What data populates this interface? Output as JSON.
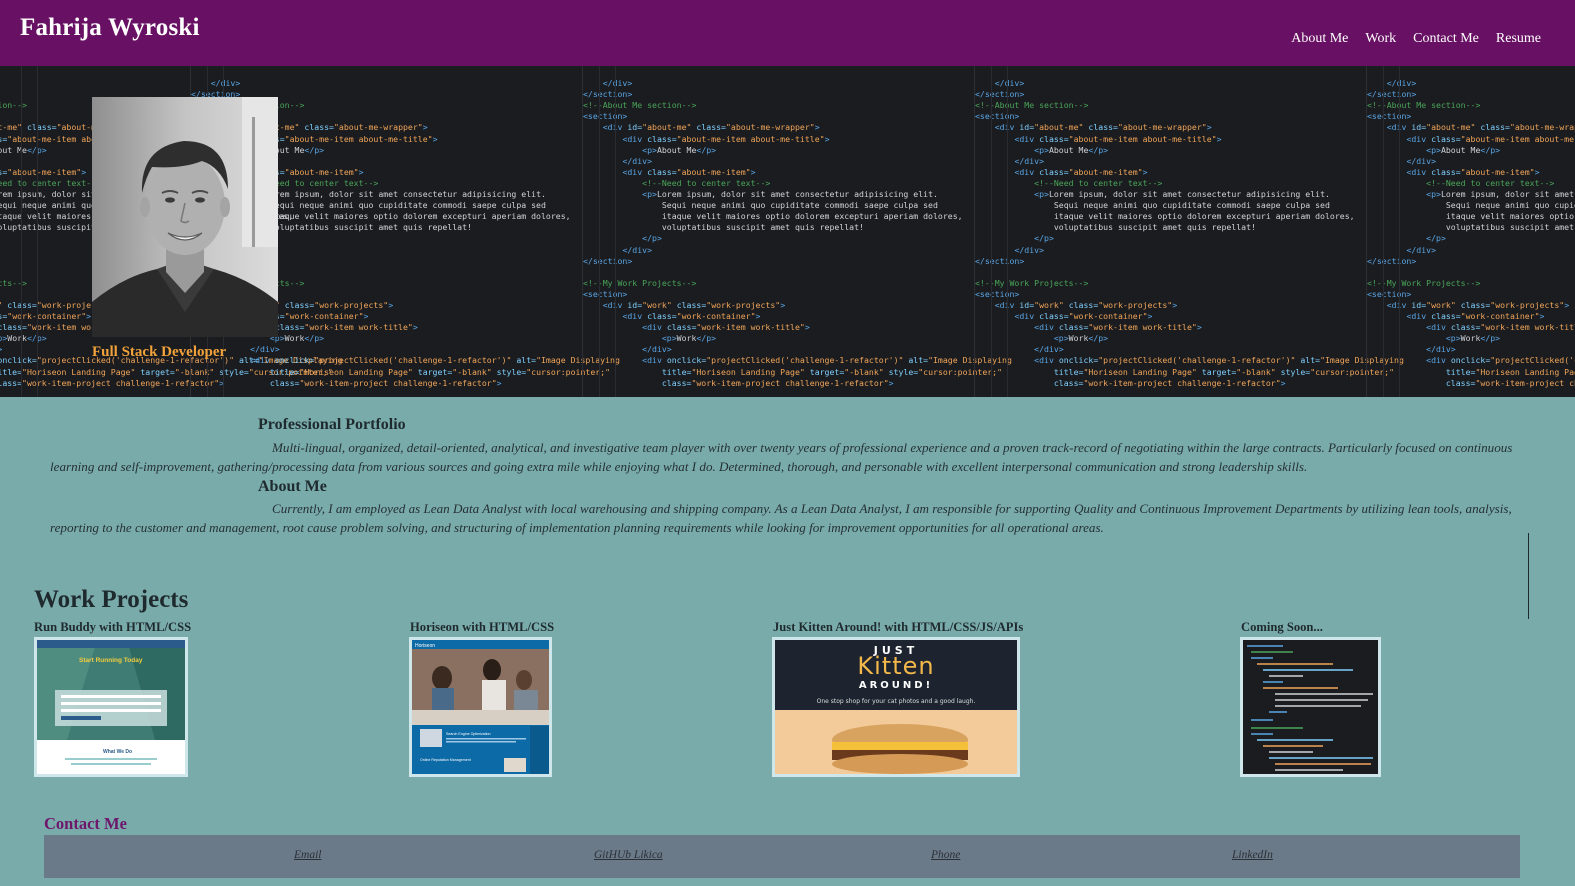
{
  "header": {
    "title": "Fahrija Wyroski",
    "nav": [
      "About Me",
      "Work",
      "Contact Me",
      "Resume"
    ]
  },
  "hero": {
    "role": "Full Stack Developer"
  },
  "portfolio": {
    "heading": "Professional Portfolio",
    "text": "Multi-lingual, organized, detail-oriented, analytical, and investigative team player with over twenty years of professional experience and a proven track-record of negotiating within the large contracts. Particularly focused on continuous learning and self-improvement, gathering/processing data from various sources and going extra mile while enjoying what I do. Determined, thorough, and personable with excellent interpersonal communication and strong leadership skills."
  },
  "about": {
    "heading": "About Me",
    "text": "Currently, I am employed as Lean Data Analyst with local warehousing and shipping company. As a Lean Data Analyst, I am responsible for supporting Quality and Continuous Improvement Departments by utilizing lean tools, analysis, reporting to the customer and management, root cause problem solving, and structuring of implementation planning requirements while looking for improvement opportunities for all operational areas."
  },
  "work": {
    "heading": "Work Projects",
    "projects": [
      {
        "title": "Run Buddy with HTML/CSS",
        "thumb_text": [
          "Start Running Today",
          "What We Do"
        ]
      },
      {
        "title": "Horiseon with HTML/CSS",
        "thumb_text": [
          "Horiseon",
          "Search Engine Optimization",
          "Online Reputation Management"
        ]
      },
      {
        "title": "Just Kitten Around! with HTML/CSS/JS/APIs",
        "thumb_text": [
          "JUST",
          "Kitten",
          "AROUND!",
          "One stop shop for your cat photos and a good laugh."
        ]
      },
      {
        "title": "Coming Soon...",
        "thumb_text": []
      }
    ]
  },
  "contact": {
    "heading": "Contact Me",
    "links": [
      "Email",
      "GitHUb Likica",
      "Phone",
      "LinkedIn"
    ]
  },
  "colors": {
    "header_bg": "#681063",
    "page_bg": "#7aabab",
    "accent_orange": "#f2a23a",
    "contact_heading": "#6d166c",
    "contact_bar": "#6b7a88"
  }
}
